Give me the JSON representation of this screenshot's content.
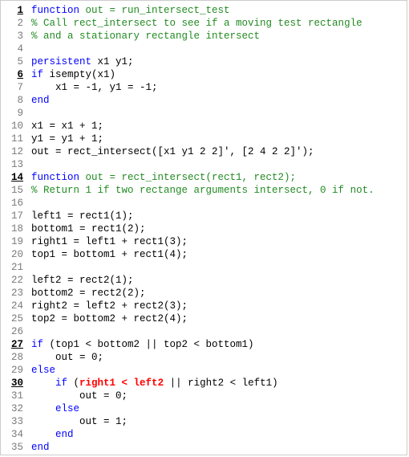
{
  "lines": [
    {
      "n": "1",
      "exec": true,
      "segs": [
        {
          "c": "kw",
          "t": "function"
        },
        {
          "c": "func-sig",
          "t": " out = run_intersect_test"
        }
      ]
    },
    {
      "n": "2",
      "exec": false,
      "segs": [
        {
          "c": "cm",
          "t": "% Call rect_intersect to see if a moving test rectangle"
        }
      ]
    },
    {
      "n": "3",
      "exec": false,
      "segs": [
        {
          "c": "cm",
          "t": "% and a stationary rectangle intersect"
        }
      ]
    },
    {
      "n": "4",
      "exec": false,
      "segs": [
        {
          "c": "nrm",
          "t": ""
        }
      ]
    },
    {
      "n": "5",
      "exec": false,
      "segs": [
        {
          "c": "kw",
          "t": "persistent"
        },
        {
          "c": "nrm",
          "t": " x1 y1;"
        }
      ]
    },
    {
      "n": "6",
      "exec": true,
      "segs": [
        {
          "c": "kw",
          "t": "if"
        },
        {
          "c": "nrm",
          "t": " isempty(x1)"
        }
      ]
    },
    {
      "n": "7",
      "exec": false,
      "segs": [
        {
          "c": "nrm",
          "t": "    x1 = -1, y1 = -1;"
        }
      ]
    },
    {
      "n": "8",
      "exec": false,
      "segs": [
        {
          "c": "kw",
          "t": "end"
        }
      ]
    },
    {
      "n": "9",
      "exec": false,
      "segs": [
        {
          "c": "nrm",
          "t": ""
        }
      ]
    },
    {
      "n": "10",
      "exec": false,
      "segs": [
        {
          "c": "nrm",
          "t": "x1 = x1 + 1;"
        }
      ]
    },
    {
      "n": "11",
      "exec": false,
      "segs": [
        {
          "c": "nrm",
          "t": "y1 = y1 + 1;"
        }
      ]
    },
    {
      "n": "12",
      "exec": false,
      "segs": [
        {
          "c": "nrm",
          "t": "out = rect_intersect([x1 y1 2 2]', [2 4 2 2]');"
        }
      ]
    },
    {
      "n": "13",
      "exec": false,
      "segs": [
        {
          "c": "nrm",
          "t": ""
        }
      ]
    },
    {
      "n": "14",
      "exec": true,
      "segs": [
        {
          "c": "kw",
          "t": "function"
        },
        {
          "c": "func-sig",
          "t": " out = rect_intersect(rect1, rect2);"
        }
      ]
    },
    {
      "n": "15",
      "exec": false,
      "segs": [
        {
          "c": "cm",
          "t": "% Return 1 if two rectange arguments intersect, 0 if not."
        }
      ]
    },
    {
      "n": "16",
      "exec": false,
      "segs": [
        {
          "c": "nrm",
          "t": ""
        }
      ]
    },
    {
      "n": "17",
      "exec": false,
      "segs": [
        {
          "c": "nrm",
          "t": "left1 = rect1(1);"
        }
      ]
    },
    {
      "n": "18",
      "exec": false,
      "segs": [
        {
          "c": "nrm",
          "t": "bottom1 = rect1(2);"
        }
      ]
    },
    {
      "n": "19",
      "exec": false,
      "segs": [
        {
          "c": "nrm",
          "t": "right1 = left1 + rect1(3);"
        }
      ]
    },
    {
      "n": "20",
      "exec": false,
      "segs": [
        {
          "c": "nrm",
          "t": "top1 = bottom1 + rect1(4);"
        }
      ]
    },
    {
      "n": "21",
      "exec": false,
      "segs": [
        {
          "c": "nrm",
          "t": ""
        }
      ]
    },
    {
      "n": "22",
      "exec": false,
      "segs": [
        {
          "c": "nrm",
          "t": "left2 = rect2(1);"
        }
      ]
    },
    {
      "n": "23",
      "exec": false,
      "segs": [
        {
          "c": "nrm",
          "t": "bottom2 = rect2(2);"
        }
      ]
    },
    {
      "n": "24",
      "exec": false,
      "segs": [
        {
          "c": "nrm",
          "t": "right2 = left2 + rect2(3);"
        }
      ]
    },
    {
      "n": "25",
      "exec": false,
      "segs": [
        {
          "c": "nrm",
          "t": "top2 = bottom2 + rect2(4);"
        }
      ]
    },
    {
      "n": "26",
      "exec": false,
      "segs": [
        {
          "c": "nrm",
          "t": ""
        }
      ]
    },
    {
      "n": "27",
      "exec": true,
      "segs": [
        {
          "c": "kw",
          "t": "if"
        },
        {
          "c": "nrm",
          "t": " (top1 < bottom2 || top2 < bottom1)"
        }
      ]
    },
    {
      "n": "28",
      "exec": false,
      "segs": [
        {
          "c": "nrm",
          "t": "    out = 0;"
        }
      ]
    },
    {
      "n": "29",
      "exec": false,
      "segs": [
        {
          "c": "kw",
          "t": "else"
        }
      ]
    },
    {
      "n": "30",
      "exec": true,
      "segs": [
        {
          "c": "nrm",
          "t": "    "
        },
        {
          "c": "kw",
          "t": "if"
        },
        {
          "c": "nrm",
          "t": " ("
        },
        {
          "c": "err",
          "t": "right1 < left2"
        },
        {
          "c": "nrm",
          "t": " || right2 < left1)"
        }
      ]
    },
    {
      "n": "31",
      "exec": false,
      "segs": [
        {
          "c": "nrm",
          "t": "        out = 0;"
        }
      ]
    },
    {
      "n": "32",
      "exec": false,
      "segs": [
        {
          "c": "nrm",
          "t": "    "
        },
        {
          "c": "kw",
          "t": "else"
        }
      ]
    },
    {
      "n": "33",
      "exec": false,
      "segs": [
        {
          "c": "nrm",
          "t": "        out = 1;"
        }
      ]
    },
    {
      "n": "34",
      "exec": false,
      "segs": [
        {
          "c": "nrm",
          "t": "    "
        },
        {
          "c": "kw",
          "t": "end"
        }
      ]
    },
    {
      "n": "35",
      "exec": false,
      "segs": [
        {
          "c": "kw",
          "t": "end"
        }
      ]
    }
  ]
}
